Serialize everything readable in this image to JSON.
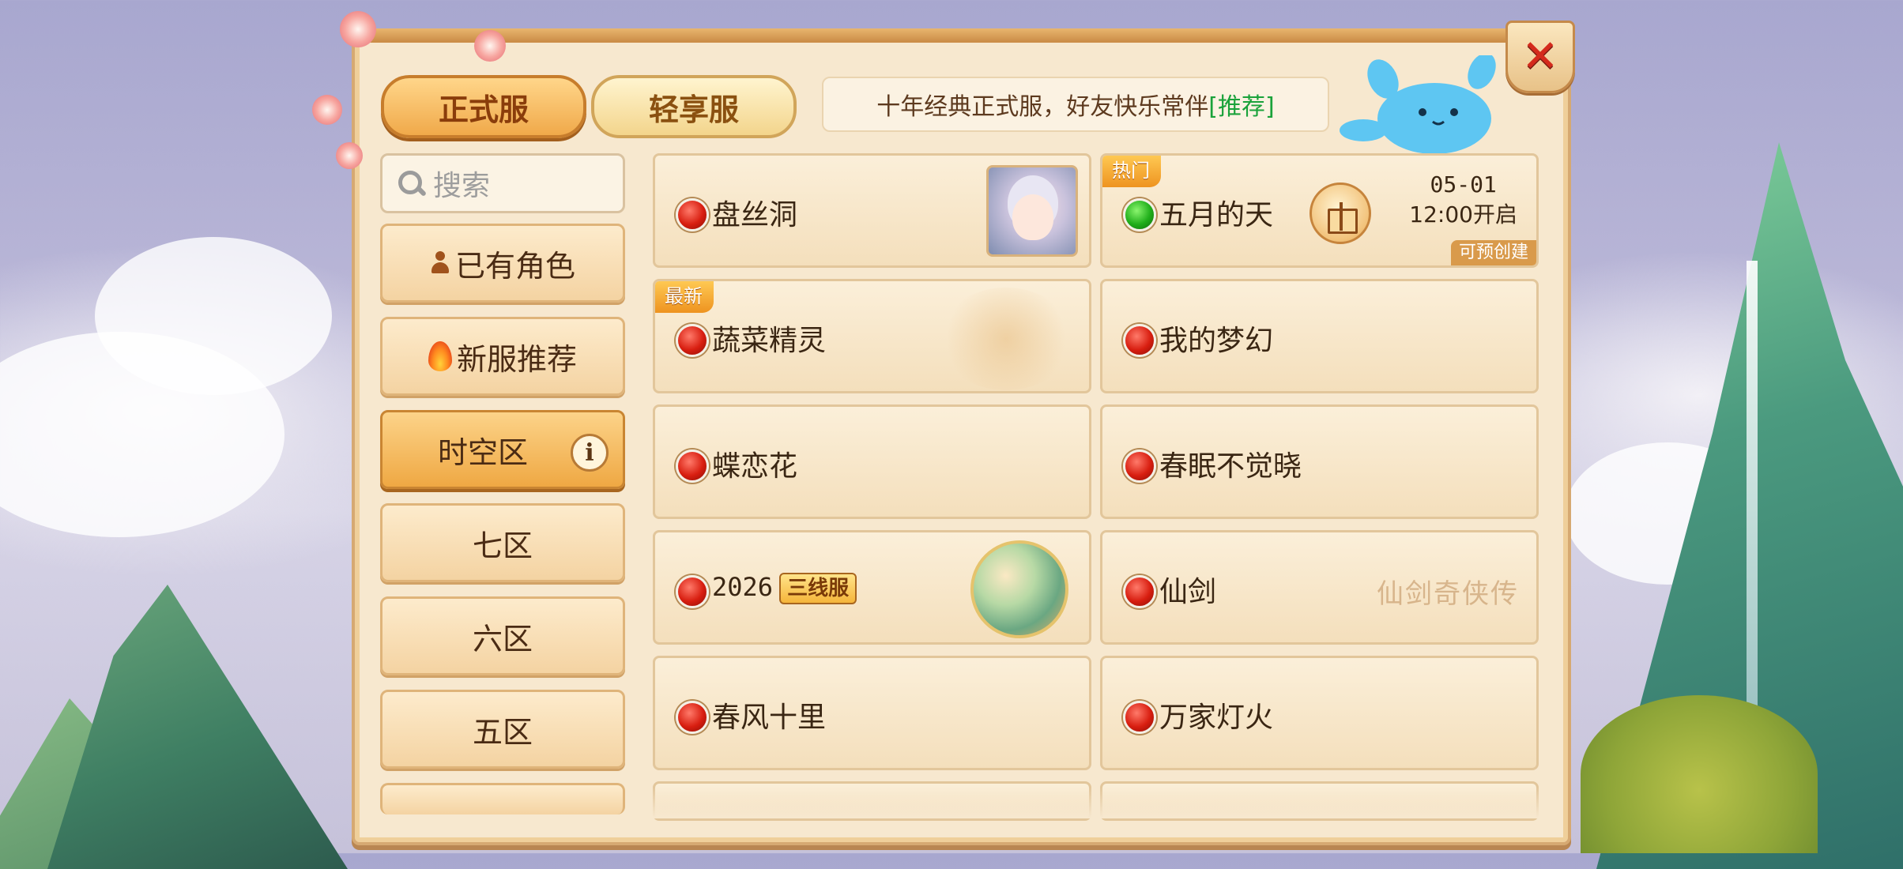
{
  "tabs": {
    "formal": "正式服",
    "light": "轻享服"
  },
  "notice": {
    "text": "十年经典正式服，好友快乐常伴",
    "tag": "[推荐]"
  },
  "search": {
    "placeholder": "搜索"
  },
  "sidebar": {
    "items": [
      {
        "label": "已有角色",
        "icon": "person-icon"
      },
      {
        "label": "新服推荐",
        "icon": "fire-icon"
      },
      {
        "label": "时空区",
        "icon": "info-icon",
        "active": true
      },
      {
        "label": "七区"
      },
      {
        "label": "六区"
      },
      {
        "label": "五区"
      }
    ]
  },
  "servers": [
    {
      "name": "盘丝洞",
      "status": "red"
    },
    {
      "name": "五月的天",
      "status": "green",
      "corner_tag": "热门",
      "open_date": "05-01",
      "open_time": "12:00开启",
      "precreate": "可预创建"
    },
    {
      "name": "蔬菜精灵",
      "status": "red",
      "corner_tag": "最新"
    },
    {
      "name": "我的梦幻",
      "status": "red"
    },
    {
      "name": "蝶恋花",
      "status": "red"
    },
    {
      "name": "春眠不觉晓",
      "status": "red"
    },
    {
      "name": "2026",
      "status": "red",
      "line_badge": "三线服"
    },
    {
      "name": "仙剑",
      "status": "red",
      "decor_text": "仙剑奇侠传"
    },
    {
      "name": "春风十里",
      "status": "red"
    },
    {
      "name": "万家灯火",
      "status": "red"
    }
  ],
  "colors": {
    "accent": "#f0a94a",
    "status_red": "#d81e10",
    "status_green": "#1fae1a",
    "notice_tag": "#1aa23a"
  }
}
